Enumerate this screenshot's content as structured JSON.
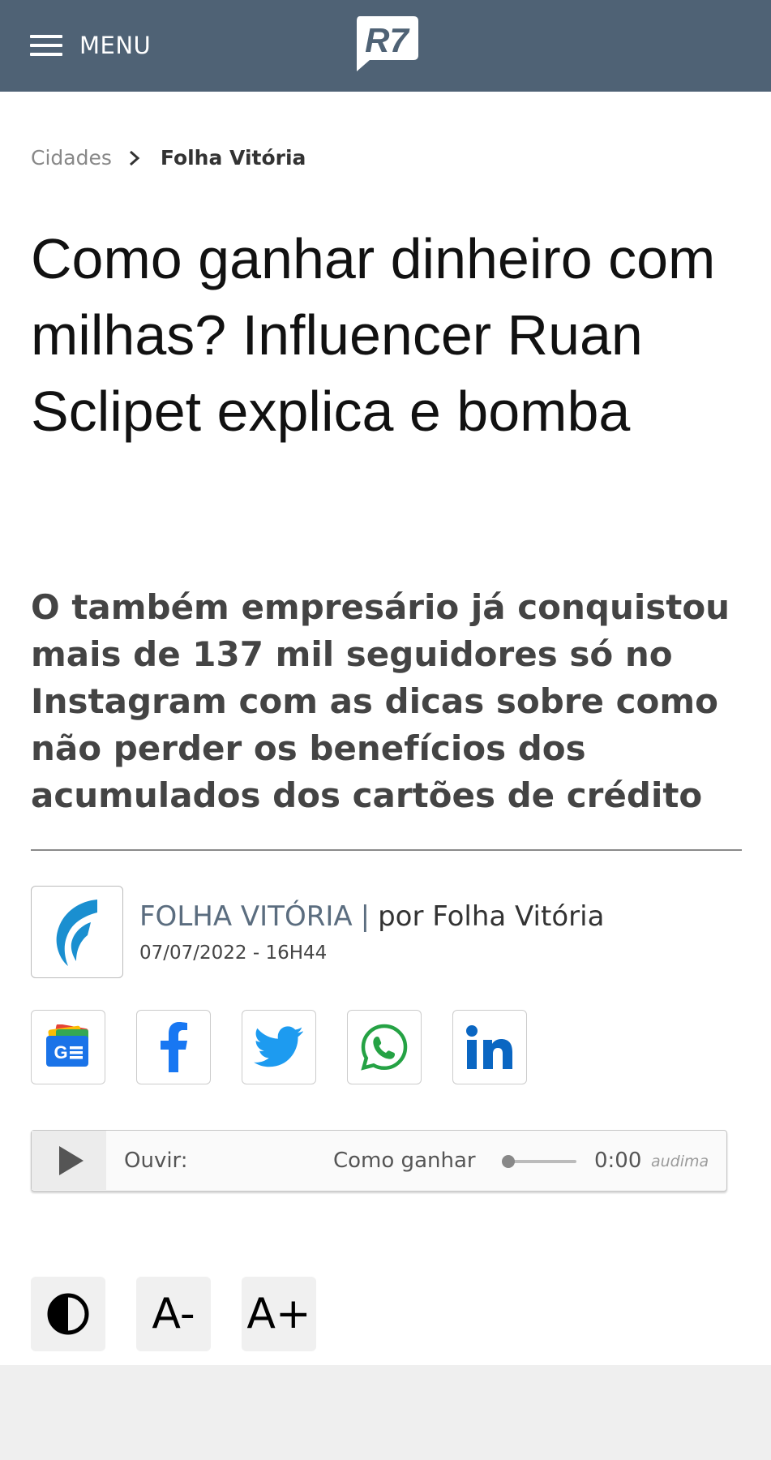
{
  "header": {
    "menu_label": "MENU",
    "logo_text": "R7",
    "bar_color": "#4f6275"
  },
  "breadcrumb": {
    "parent": "Cidades",
    "current": "Folha Vitória"
  },
  "article": {
    "headline": "Como ganhar dinheiro com milhas? Influencer Ruan Sclipet explica e bomba",
    "subtitle": "O também empresário já conquistou mais de 137 mil seguidores só no Instagram com as dicas sobre como não perder os benefícios dos acumulados dos cartões de crédito"
  },
  "author": {
    "source": "FOLHA VITÓRIA",
    "separator": "|",
    "byline": "por Folha Vitória",
    "date": "07/07/2022 - 16H44",
    "logo_color": "#1a8fd0"
  },
  "share": {
    "buttons": [
      "google-news-icon",
      "facebook-icon",
      "twitter-icon",
      "whatsapp-icon",
      "linkedin-icon"
    ],
    "colors": {
      "facebook": "#1877f2",
      "twitter": "#1d9bf0",
      "whatsapp": "#25a244",
      "linkedin": "#0a66c2"
    }
  },
  "audio_player": {
    "listen_label": "Ouvir:",
    "track_title": "Como ganhar",
    "time": "0:00",
    "brand": "audima",
    "progress": 0
  },
  "accessibility": {
    "contrast_icon": "contrast-icon",
    "decrease_label": "A-",
    "increase_label": "A+"
  }
}
